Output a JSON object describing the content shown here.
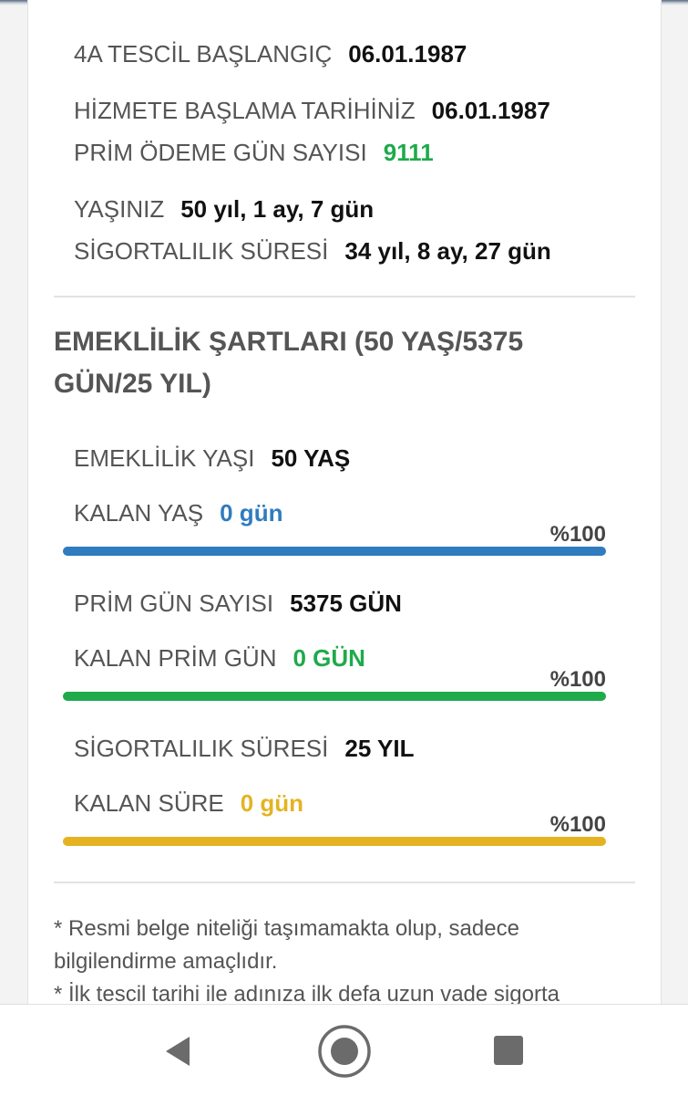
{
  "info": {
    "tescil_label": "4A TESCİL BAŞLANGIÇ",
    "tescil_value": "06.01.1987",
    "hizmet_label": "HİZMETE BAŞLAMA TARİHİNİZ",
    "hizmet_value": "06.01.1987",
    "prim_odeme_label": "PRİM ÖDEME GÜN SAYISI",
    "prim_odeme_value": "9111",
    "yas_label": "YAŞINIZ",
    "yas_value": "50 yıl, 1 ay, 7 gün",
    "sigorta_sure_label": "SİGORTALILIK SÜRESİ",
    "sigorta_sure_value": "34 yıl, 8 ay, 27 gün"
  },
  "conditions": {
    "title": "EMEKLİLİK ŞARTLARI (50 YAŞ/5375 GÜN/25 YIL)",
    "emeklilik_yasi_label": "EMEKLİLİK YAŞI",
    "emeklilik_yasi_value": "50 YAŞ",
    "kalan_yas_label": "KALAN YAŞ",
    "kalan_yas_value": "0 gün",
    "yas_percent_text": "%100",
    "yas_progress": 100,
    "prim_gun_label": "PRİM GÜN SAYISI",
    "prim_gun_value": "5375 GÜN",
    "kalan_prim_label": "KALAN PRİM GÜN",
    "kalan_prim_value": "0 GÜN",
    "prim_percent_text": "%100",
    "prim_progress": 100,
    "sigorta_label": "SİGORTALILIK SÜRESİ",
    "sigorta_value": "25 YIL",
    "kalan_sure_label": "KALAN SÜRE",
    "kalan_sure_value": "0 gün",
    "sure_percent_text": "%100",
    "sure_progress": 100
  },
  "notes": {
    "note1": "* Resmi belge niteliği taşımamakta olup, sadece bilgilendirme amaçlıdır.",
    "note2": "* İlk tescil tarihi ile adınıza ilk defa uzun vade sigorta"
  },
  "colors": {
    "blue": "#2f7cc0",
    "green": "#1faa4b",
    "yellow": "#e5b322"
  },
  "navigation": {
    "back_icon": "back-triangle-icon",
    "home_icon": "home-circle-icon",
    "recents_icon": "recents-square-icon"
  }
}
